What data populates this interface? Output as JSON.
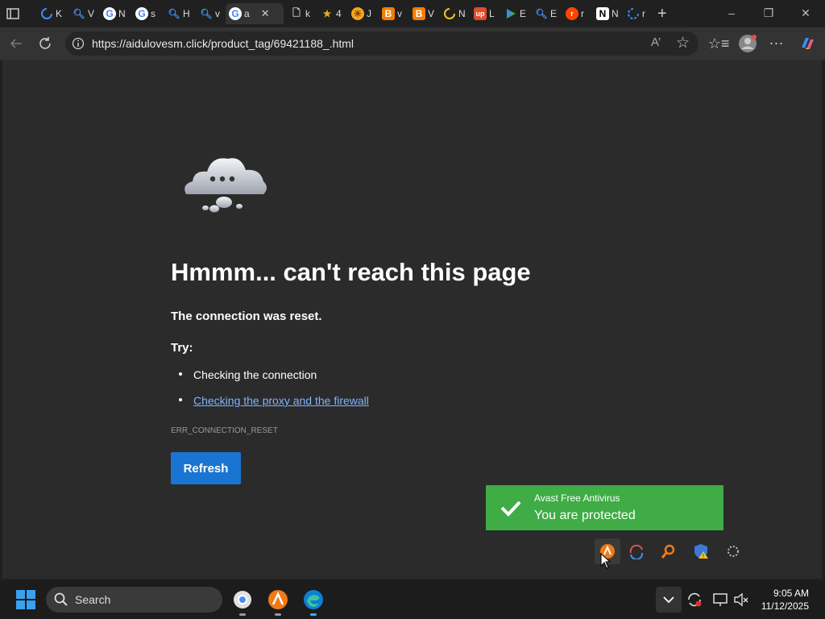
{
  "browser": {
    "tabs": [
      {
        "icon": "sidebar-icon",
        "label": ""
      },
      {
        "icon": "loading-icon",
        "label": "K"
      },
      {
        "icon": "search-icon",
        "label": "V"
      },
      {
        "icon": "google-icon",
        "label": "N"
      },
      {
        "icon": "google-icon",
        "label": "s"
      },
      {
        "icon": "search-icon",
        "label": "H"
      },
      {
        "icon": "search-icon",
        "label": "v"
      },
      {
        "icon": "google-icon",
        "label": "a",
        "active": true
      },
      {
        "icon": "file-icon",
        "label": "k"
      },
      {
        "icon": "star-icon",
        "label": "4"
      },
      {
        "icon": "lion-icon",
        "label": "J"
      },
      {
        "icon": "blogger-icon",
        "label": "v"
      },
      {
        "icon": "blogger-icon",
        "label": "V"
      },
      {
        "icon": "ring-icon",
        "label": "N"
      },
      {
        "icon": "upwork-icon",
        "label": "L"
      },
      {
        "icon": "play-icon",
        "label": "E"
      },
      {
        "icon": "search-icon",
        "label": "E"
      },
      {
        "icon": "reddit-icon",
        "label": "r"
      },
      {
        "icon": "notion-icon",
        "label": "N"
      },
      {
        "icon": "loading-icon",
        "label": "r"
      }
    ],
    "new_tab": "+",
    "url": "https://aidulovesm.click/product_tag/69421188_.html"
  },
  "error_page": {
    "title": "Hmmm... can't reach this page",
    "reason": "The connection was reset.",
    "try_label": "Try:",
    "suggestions": [
      "Checking the connection",
      "Checking the proxy and the firewall"
    ],
    "error_code": "ERR_CONNECTION_RESET",
    "refresh_label": "Refresh"
  },
  "notification": {
    "app": "Avast Free Antivirus",
    "message": "You are protected",
    "color": "#3fac46"
  },
  "taskbar": {
    "search_label": "Search",
    "time": "9:05 AM",
    "date": "11/12/2025"
  }
}
